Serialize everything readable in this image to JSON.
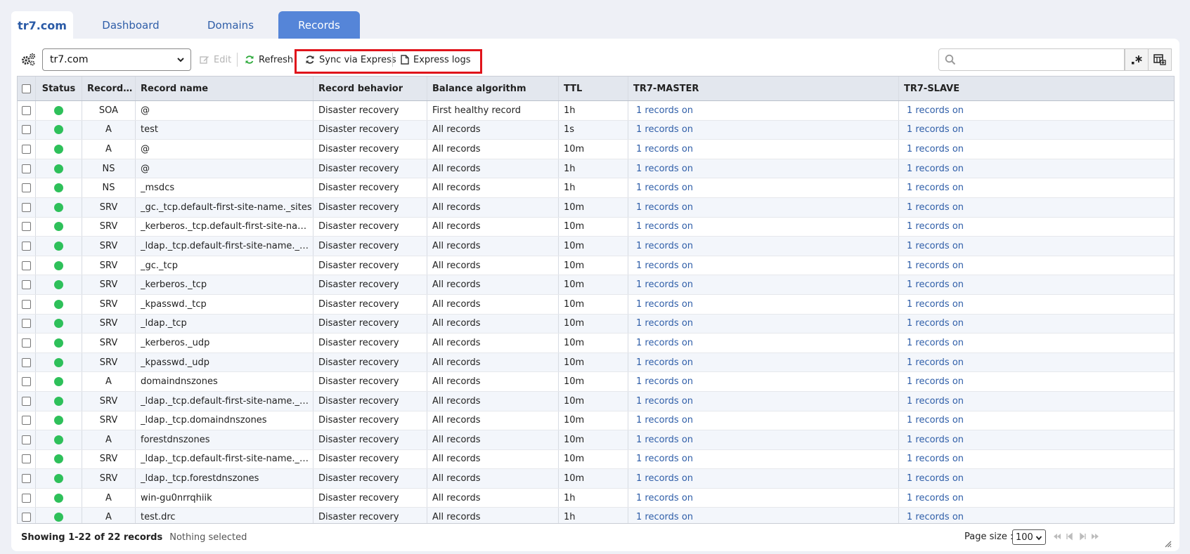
{
  "tabs": [
    {
      "label": "tr7.com"
    },
    {
      "label": "Dashboard"
    },
    {
      "label": "Domains"
    },
    {
      "label": "Records"
    }
  ],
  "toolbar": {
    "domain_select": "tr7.com",
    "edit_label": "Edit",
    "refresh_label": "Refresh",
    "sync_label": "Sync via Express",
    "logs_label": "Express logs",
    "search_placeholder": ""
  },
  "table": {
    "columns": [
      "Status",
      "Record ty...",
      "Record name",
      "Record behavior",
      "Balance algorithm",
      "TTL",
      "TR7-MASTER",
      "TR7-SLAVE"
    ],
    "rows": [
      {
        "type": "SOA",
        "name": "@",
        "behavior": "Disaster recovery",
        "algo": "First healthy record",
        "ttl": "1h",
        "master": "1 records on",
        "slave": "1 records on"
      },
      {
        "type": "A",
        "name": "test",
        "behavior": "Disaster recovery",
        "algo": "All records",
        "ttl": "1s",
        "master": "1 records on",
        "slave": "1 records on"
      },
      {
        "type": "A",
        "name": "@",
        "behavior": "Disaster recovery",
        "algo": "All records",
        "ttl": "10m",
        "master": "1 records on",
        "slave": "1 records on"
      },
      {
        "type": "NS",
        "name": "@",
        "behavior": "Disaster recovery",
        "algo": "All records",
        "ttl": "1h",
        "master": "1 records on",
        "slave": "1 records on"
      },
      {
        "type": "NS",
        "name": "_msdcs",
        "behavior": "Disaster recovery",
        "algo": "All records",
        "ttl": "1h",
        "master": "1 records on",
        "slave": "1 records on"
      },
      {
        "type": "SRV",
        "name": "_gc._tcp.default-first-site-name._sites",
        "behavior": "Disaster recovery",
        "algo": "All records",
        "ttl": "10m",
        "master": "1 records on",
        "slave": "1 records on"
      },
      {
        "type": "SRV",
        "name": "_kerberos._tcp.default-first-site-nam...",
        "behavior": "Disaster recovery",
        "algo": "All records",
        "ttl": "10m",
        "master": "1 records on",
        "slave": "1 records on"
      },
      {
        "type": "SRV",
        "name": "_ldap._tcp.default-first-site-name._sit...",
        "behavior": "Disaster recovery",
        "algo": "All records",
        "ttl": "10m",
        "master": "1 records on",
        "slave": "1 records on"
      },
      {
        "type": "SRV",
        "name": "_gc._tcp",
        "behavior": "Disaster recovery",
        "algo": "All records",
        "ttl": "10m",
        "master": "1 records on",
        "slave": "1 records on"
      },
      {
        "type": "SRV",
        "name": "_kerberos._tcp",
        "behavior": "Disaster recovery",
        "algo": "All records",
        "ttl": "10m",
        "master": "1 records on",
        "slave": "1 records on"
      },
      {
        "type": "SRV",
        "name": "_kpasswd._tcp",
        "behavior": "Disaster recovery",
        "algo": "All records",
        "ttl": "10m",
        "master": "1 records on",
        "slave": "1 records on"
      },
      {
        "type": "SRV",
        "name": "_ldap._tcp",
        "behavior": "Disaster recovery",
        "algo": "All records",
        "ttl": "10m",
        "master": "1 records on",
        "slave": "1 records on"
      },
      {
        "type": "SRV",
        "name": "_kerberos._udp",
        "behavior": "Disaster recovery",
        "algo": "All records",
        "ttl": "10m",
        "master": "1 records on",
        "slave": "1 records on"
      },
      {
        "type": "SRV",
        "name": "_kpasswd._udp",
        "behavior": "Disaster recovery",
        "algo": "All records",
        "ttl": "10m",
        "master": "1 records on",
        "slave": "1 records on"
      },
      {
        "type": "A",
        "name": "domaindnszones",
        "behavior": "Disaster recovery",
        "algo": "All records",
        "ttl": "10m",
        "master": "1 records on",
        "slave": "1 records on"
      },
      {
        "type": "SRV",
        "name": "_ldap._tcp.default-first-site-name._sit...",
        "behavior": "Disaster recovery",
        "algo": "All records",
        "ttl": "10m",
        "master": "1 records on",
        "slave": "1 records on"
      },
      {
        "type": "SRV",
        "name": "_ldap._tcp.domaindnszones",
        "behavior": "Disaster recovery",
        "algo": "All records",
        "ttl": "10m",
        "master": "1 records on",
        "slave": "1 records on"
      },
      {
        "type": "A",
        "name": "forestdnszones",
        "behavior": "Disaster recovery",
        "algo": "All records",
        "ttl": "10m",
        "master": "1 records on",
        "slave": "1 records on"
      },
      {
        "type": "SRV",
        "name": "_ldap._tcp.default-first-site-name._sit...",
        "behavior": "Disaster recovery",
        "algo": "All records",
        "ttl": "10m",
        "master": "1 records on",
        "slave": "1 records on"
      },
      {
        "type": "SRV",
        "name": "_ldap._tcp.forestdnszones",
        "behavior": "Disaster recovery",
        "algo": "All records",
        "ttl": "10m",
        "master": "1 records on",
        "slave": "1 records on"
      },
      {
        "type": "A",
        "name": "win-gu0nrrqhiik",
        "behavior": "Disaster recovery",
        "algo": "All records",
        "ttl": "1h",
        "master": "1 records on",
        "slave": "1 records on"
      },
      {
        "type": "A",
        "name": "test.drc",
        "behavior": "Disaster recovery",
        "algo": "All records",
        "ttl": "1h",
        "master": "1 records on",
        "slave": "1 records on"
      }
    ]
  },
  "footer": {
    "showing": "Showing 1-22 of 22 records",
    "selection": "Nothing selected",
    "page_size_label": "Page size :",
    "page_size": "100"
  },
  "colors": {
    "accent": "#5585d8",
    "link": "#2f5ea8",
    "status_ok": "#2ec05a",
    "highlight": "#e0141b"
  },
  "icons": [
    "gears-icon",
    "edit-icon",
    "refresh-icon",
    "sync-icon",
    "document-icon",
    "search-icon",
    "regex-icon",
    "column-chooser-icon"
  ]
}
